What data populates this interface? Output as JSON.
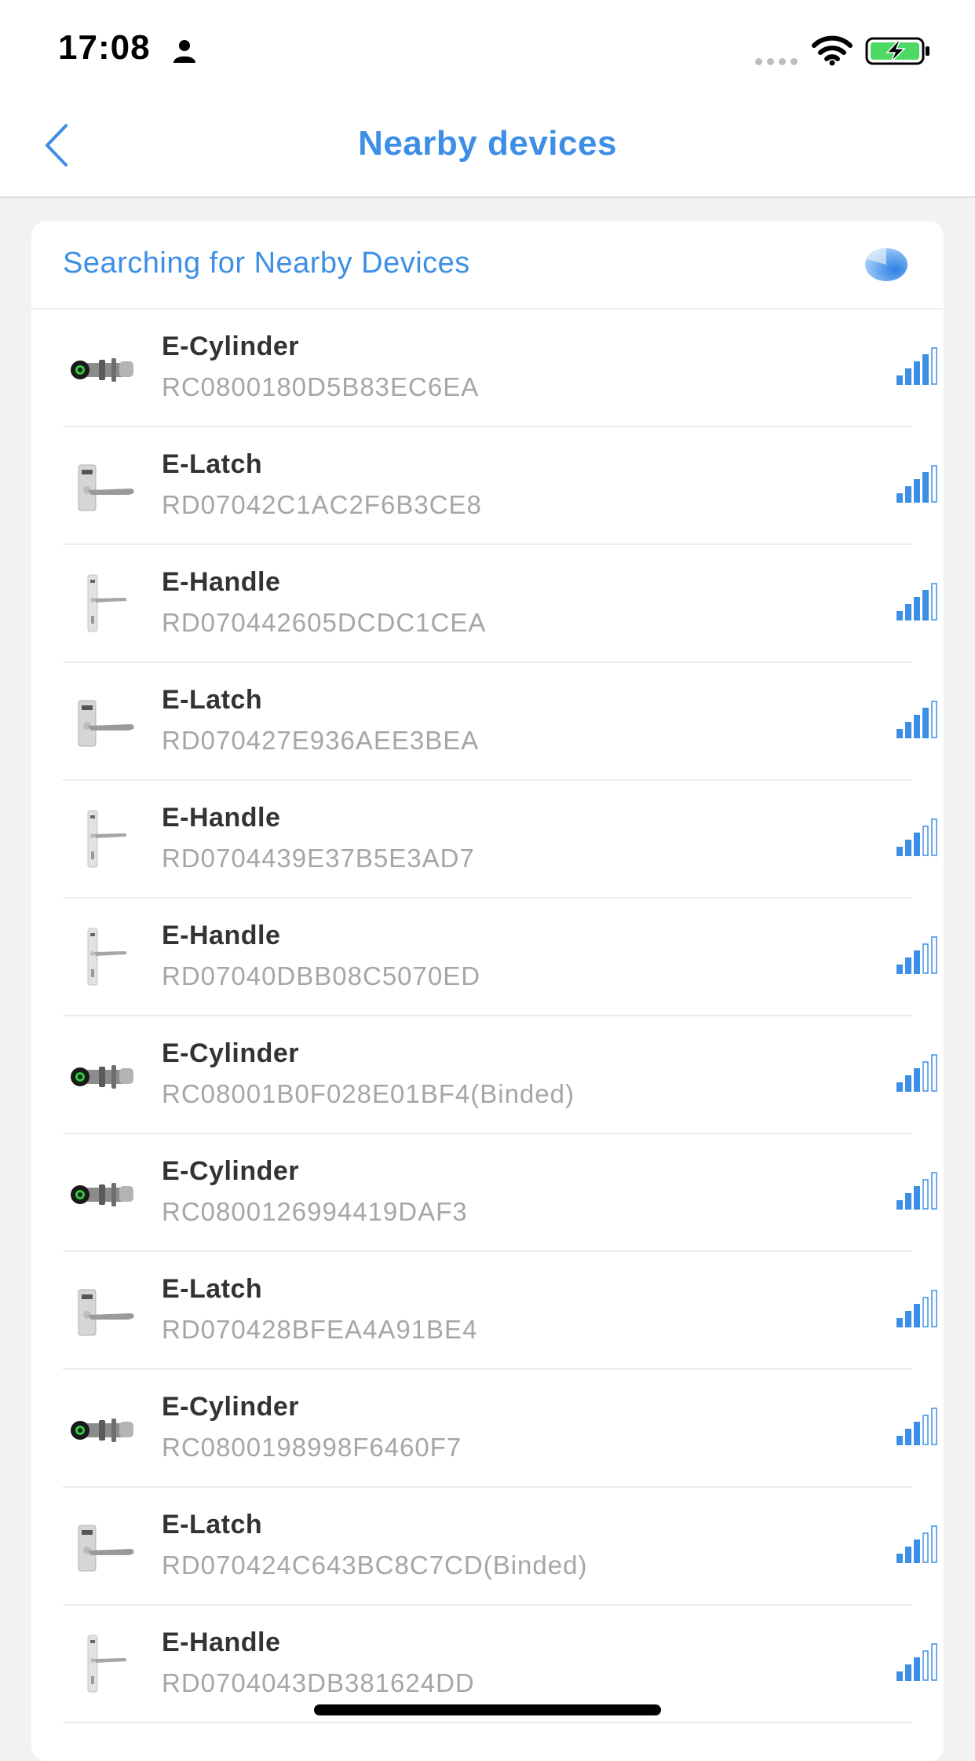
{
  "status_bar": {
    "time": "17:08",
    "person_icon": "person-icon",
    "cellular_icon": "cellular-dots-icon",
    "wifi_icon": "wifi-icon",
    "battery_icon": "battery-charging-icon",
    "battery_color": "#4cd964"
  },
  "nav": {
    "title": "Nearby devices",
    "back_icon": "chevron-left-icon",
    "accent": "#3d8fe6"
  },
  "search": {
    "text": "Searching for Nearby Devices",
    "spinner_icon": "spinner-icon"
  },
  "devices": [
    {
      "name": "E-Cylinder",
      "id": "RC0800180D5B83EC6EA",
      "type": "cylinder",
      "signal": 4
    },
    {
      "name": "E-Latch",
      "id": "RD07042C1AC2F6B3CE8",
      "type": "latch",
      "signal": 4
    },
    {
      "name": "E-Handle",
      "id": "RD070442605DCDC1CEA",
      "type": "handle",
      "signal": 4
    },
    {
      "name": "E-Latch",
      "id": "RD070427E936AEE3BEA",
      "type": "latch",
      "signal": 4
    },
    {
      "name": "E-Handle",
      "id": "RD0704439E37B5E3AD7",
      "type": "handle",
      "signal": 3
    },
    {
      "name": "E-Handle",
      "id": "RD07040DBB08C5070ED",
      "type": "handle",
      "signal": 3
    },
    {
      "name": "E-Cylinder",
      "id": "RC08001B0F028E01BF4(Binded)",
      "type": "cylinder",
      "signal": 3
    },
    {
      "name": "E-Cylinder",
      "id": "RC0800126994419DAF3",
      "type": "cylinder",
      "signal": 3
    },
    {
      "name": "E-Latch",
      "id": "RD070428BFEA4A91BE4",
      "type": "latch",
      "signal": 3
    },
    {
      "name": "E-Cylinder",
      "id": "RC0800198998F6460F7",
      "type": "cylinder",
      "signal": 3
    },
    {
      "name": "E-Latch",
      "id": "RD070424C643BC8C7CD(Binded)",
      "type": "latch",
      "signal": 3
    },
    {
      "name": "E-Handle",
      "id": "RD0704043DB381624DD",
      "type": "handle",
      "signal": 3
    }
  ]
}
